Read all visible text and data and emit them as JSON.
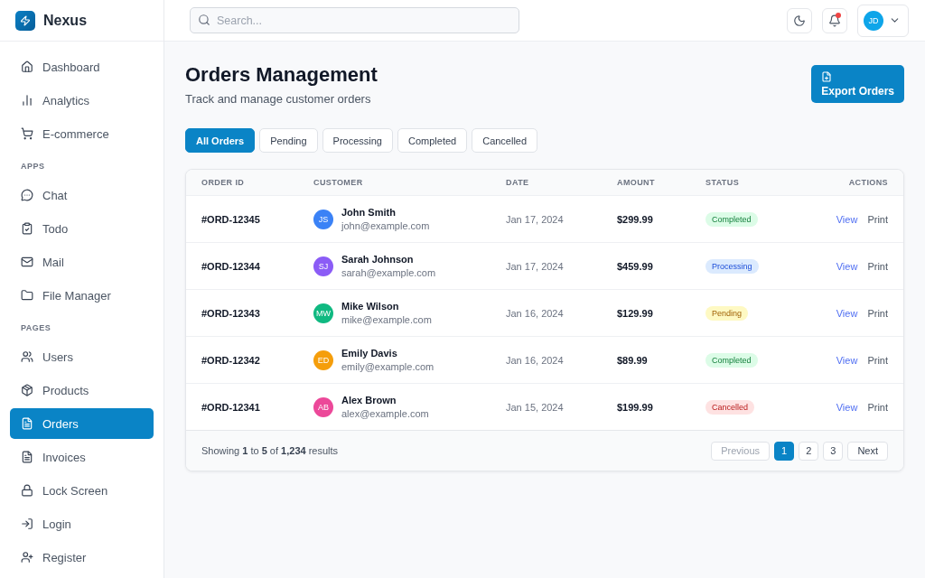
{
  "brand": {
    "name": "Nexus"
  },
  "sidebar": {
    "sections": [
      {
        "items": [
          {
            "label": "Dashboard",
            "selected": false
          },
          {
            "label": "Analytics",
            "selected": false
          },
          {
            "label": "E-commerce",
            "selected": false
          }
        ]
      },
      {
        "heading": "APPS",
        "items": [
          {
            "label": "Chat",
            "selected": false
          },
          {
            "label": "Todo",
            "selected": false
          },
          {
            "label": "Mail",
            "selected": false
          },
          {
            "label": "File Manager",
            "selected": false
          }
        ]
      },
      {
        "heading": "PAGES",
        "items": [
          {
            "label": "Users",
            "selected": false
          },
          {
            "label": "Products",
            "selected": false
          },
          {
            "label": "Orders",
            "selected": true
          },
          {
            "label": "Invoices",
            "selected": false
          },
          {
            "label": "Lock Screen",
            "selected": false
          },
          {
            "label": "Login",
            "selected": false
          },
          {
            "label": "Register",
            "selected": false
          }
        ]
      }
    ]
  },
  "header": {
    "search": {
      "placeholder": "Search..."
    },
    "notifications_unread": true,
    "user": {
      "initials": "JD"
    }
  },
  "page": {
    "title": "Orders Management",
    "subtitle": "Track and manage customer orders",
    "export_button": "Export Orders"
  },
  "filters": [
    {
      "label": "All Orders",
      "selected": true
    },
    {
      "label": "Pending",
      "selected": false
    },
    {
      "label": "Processing",
      "selected": false
    },
    {
      "label": "Completed",
      "selected": false
    },
    {
      "label": "Cancelled",
      "selected": false
    }
  ],
  "table": {
    "columns": [
      "ORDER ID",
      "CUSTOMER",
      "DATE",
      "AMOUNT",
      "STATUS",
      "ACTIONS"
    ],
    "rows": [
      {
        "order_id": "#ORD-12345",
        "customer": {
          "initials": "JS",
          "name": "John Smith",
          "email": "john@example.com",
          "color": "#3b82f6"
        },
        "date": "Jan 17, 2024",
        "amount": "$299.99",
        "status": {
          "label": "Completed",
          "kind": "completed"
        },
        "actions": [
          {
            "label": "View",
            "kind": "primary"
          },
          {
            "label": "Print",
            "kind": "secondary"
          }
        ]
      },
      {
        "order_id": "#ORD-12344",
        "customer": {
          "initials": "SJ",
          "name": "Sarah Johnson",
          "email": "sarah@example.com",
          "color": "#8b5cf6"
        },
        "date": "Jan 17, 2024",
        "amount": "$459.99",
        "status": {
          "label": "Processing",
          "kind": "processing"
        },
        "actions": [
          {
            "label": "View",
            "kind": "primary"
          },
          {
            "label": "Print",
            "kind": "secondary"
          }
        ]
      },
      {
        "order_id": "#ORD-12343",
        "customer": {
          "initials": "MW",
          "name": "Mike Wilson",
          "email": "mike@example.com",
          "color": "#10b981"
        },
        "date": "Jan 16, 2024",
        "amount": "$129.99",
        "status": {
          "label": "Pending",
          "kind": "pending"
        },
        "actions": [
          {
            "label": "View",
            "kind": "primary"
          },
          {
            "label": "Print",
            "kind": "secondary"
          }
        ]
      },
      {
        "order_id": "#ORD-12342",
        "customer": {
          "initials": "ED",
          "name": "Emily Davis",
          "email": "emily@example.com",
          "color": "#f59e0b"
        },
        "date": "Jan 16, 2024",
        "amount": "$89.99",
        "status": {
          "label": "Completed",
          "kind": "completed"
        },
        "actions": [
          {
            "label": "View",
            "kind": "primary"
          },
          {
            "label": "Print",
            "kind": "secondary"
          }
        ]
      },
      {
        "order_id": "#ORD-12341",
        "customer": {
          "initials": "AB",
          "name": "Alex Brown",
          "email": "alex@example.com",
          "color": "#ec4899"
        },
        "date": "Jan 15, 2024",
        "amount": "$199.99",
        "status": {
          "label": "Cancelled",
          "kind": "cancelled"
        },
        "actions": [
          {
            "label": "View",
            "kind": "primary"
          },
          {
            "label": "Print",
            "kind": "secondary"
          }
        ]
      }
    ]
  },
  "footer": {
    "summary": "Showing **1** to **5** of **1,234** results",
    "previous": {
      "label": "Previous",
      "disabled": true
    },
    "pages": [
      {
        "label": "1",
        "selected": true
      },
      {
        "label": "2",
        "selected": false
      },
      {
        "label": "3",
        "selected": false
      }
    ],
    "next": {
      "label": "Next",
      "disabled": false
    }
  }
}
